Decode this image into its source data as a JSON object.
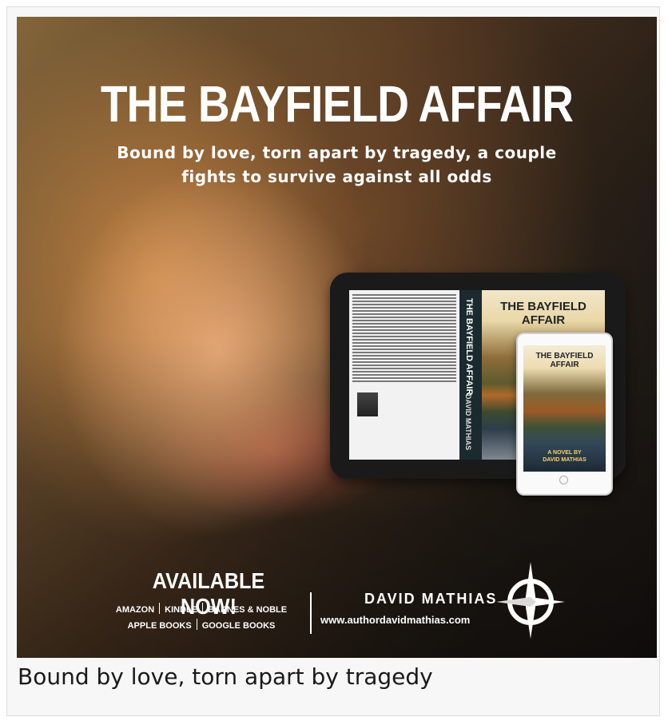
{
  "banner": {
    "title": "THE BAYFIELD AFFAIR",
    "tagline": "Bound by love, torn apart by tragedy, a couple fights to survive against all odds",
    "available": "AVAILABLE NOW!",
    "stores_row1": [
      "AMAZON",
      "KINDLE",
      "BARNES & NOBLE"
    ],
    "stores_row2": [
      "APPLE BOOKS",
      "GOOGLE BOOKS"
    ],
    "brand": "DAVID MATHIAS",
    "website": "www.authordavidmathias.com",
    "devices": {
      "cover_title": "THE BAYFIELD AFFAIR",
      "spine_title": "THE BAYFIELD AFFAIR",
      "spine_author": "DAVID MATHIAS",
      "phone_title": "THE BAYFIELD AFFAIR",
      "phone_subtitle": "A NOVEL BY",
      "phone_author": "DAVID MATHIAS"
    }
  },
  "caption": "Bound by love, torn apart by tragedy",
  "colors": {
    "background": "#ffffff",
    "card": "#f7f7f7",
    "text_light": "#ffffff",
    "caption_text": "#1a1a1a"
  }
}
